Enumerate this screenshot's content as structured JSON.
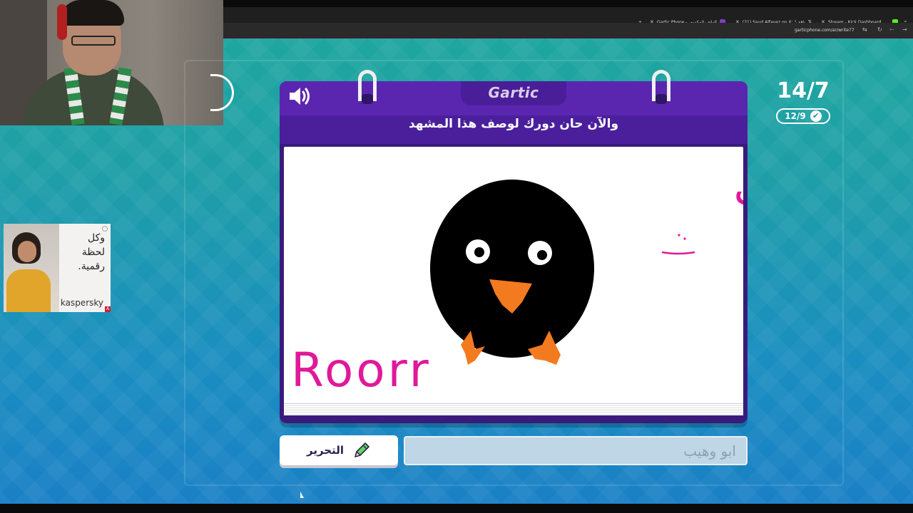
{
  "browser": {
    "tabs": [
      {
        "title": "Gartic Phone - الهاتف المكسور",
        "favicon_color": "#7b3fc9"
      },
      {
        "title": "(21) Saud Alfayez on X: \"ناقف",
        "favicon_color": "#ffffff"
      },
      {
        "title": "Stream - Kick Dashboard",
        "favicon_color": "#53fc18"
      }
    ],
    "new_tab_icon": "+",
    "url": "garticphone.com/ar/write77"
  },
  "ad": {
    "text_lines": [
      "وكل",
      "لحظة",
      "رقمية."
    ],
    "brand": "kaspersky"
  },
  "game": {
    "logo": "Gartic",
    "prompt": "والآن حان دورك لوصف هذا المشهد",
    "round_counter": "14/7",
    "done_count": "12/9",
    "edit_label": "التحرير",
    "answer_value": "ابو وهيب",
    "drawing": {
      "text_latin": "Roorr",
      "text_arabic": "حول",
      "colors": {
        "ink": "#e0199a",
        "body": "#000000",
        "beak": "#f47a20"
      }
    },
    "colors": {
      "board": "#5a26b0",
      "accent": "#ffffff"
    }
  }
}
